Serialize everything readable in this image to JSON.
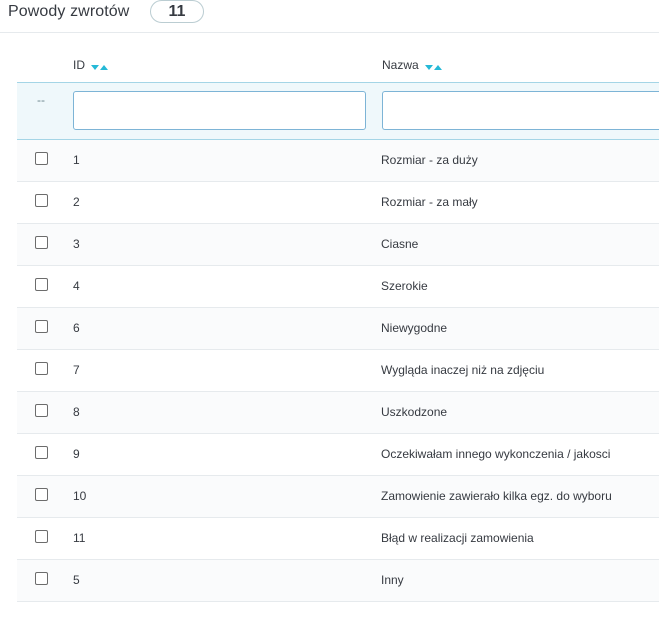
{
  "header": {
    "title": "Powody zwrotów",
    "count": "11"
  },
  "table": {
    "columns": [
      {
        "label": "ID"
      },
      {
        "label": "Nazwa"
      }
    ],
    "filter_placeholder": "--",
    "rows": [
      {
        "id": "1",
        "name": "Rozmiar - za duży"
      },
      {
        "id": "2",
        "name": "Rozmiar - za mały"
      },
      {
        "id": "3",
        "name": "Ciasne"
      },
      {
        "id": "4",
        "name": "Szerokie"
      },
      {
        "id": "6",
        "name": "Niewygodne"
      },
      {
        "id": "7",
        "name": "Wygląda inaczej niż na zdjęciu"
      },
      {
        "id": "8",
        "name": "Uszkodzone"
      },
      {
        "id": "9",
        "name": "Oczekiwałam innego wykonczenia / jakosci"
      },
      {
        "id": "10",
        "name": "Zamowienie zawierało kilka egz. do wyboru"
      },
      {
        "id": "11",
        "name": "Błąd w realizacji zamowienia"
      },
      {
        "id": "5",
        "name": "Inny"
      }
    ]
  },
  "colors": {
    "accent": "#25b9d7",
    "filter_bg": "#eff8fb"
  }
}
